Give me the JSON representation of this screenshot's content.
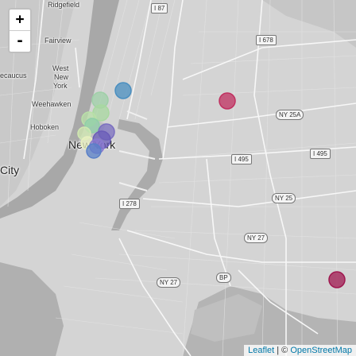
{
  "zoom": {
    "in_label": "+",
    "out_label": "-"
  },
  "attribution": {
    "leaflet": "Leaflet",
    "separator": " | © ",
    "osm": "OpenStreetMap"
  },
  "places": {
    "ridgefield": "Ridgefield",
    "fairview": "Fairview",
    "secaucus": "ecaucus",
    "west_new_york_1": "West",
    "west_new_york_2": "New",
    "west_new_york_3": "York",
    "weehawken": "Weehawken",
    "hoboken": "Hoboken",
    "new_york": "New York",
    "city": "City"
  },
  "shields": {
    "i87": "I 87",
    "i678": "I 678",
    "ny25a": "NY 25A",
    "i495_a": "I 495",
    "i495_b": "I 495",
    "ny25": "NY 25",
    "i278": "I 278",
    "ny27_a": "NY 27",
    "ny27_b": "NY 27",
    "bp": "BP"
  },
  "markers": [
    {
      "name": "marker-1",
      "color": "#4a8fc0"
    },
    {
      "name": "marker-2",
      "color": "#9fd0a8"
    },
    {
      "name": "marker-3",
      "color": "#a8d8a0"
    },
    {
      "name": "marker-4",
      "color": "#b9e0a8"
    },
    {
      "name": "marker-5",
      "color": "#8fcfa8"
    },
    {
      "name": "marker-6",
      "color": "#d0e8b0"
    },
    {
      "name": "marker-7",
      "color": "#e8f0c0"
    },
    {
      "name": "marker-8",
      "color": "#7b6fc0"
    },
    {
      "name": "marker-9",
      "color": "#6a5cb8"
    },
    {
      "name": "marker-10",
      "color": "#8a7ad0"
    },
    {
      "name": "marker-11",
      "color": "#5a80c8"
    },
    {
      "name": "marker-12",
      "color": "#c03060"
    },
    {
      "name": "marker-13",
      "color": "#a01850"
    }
  ]
}
